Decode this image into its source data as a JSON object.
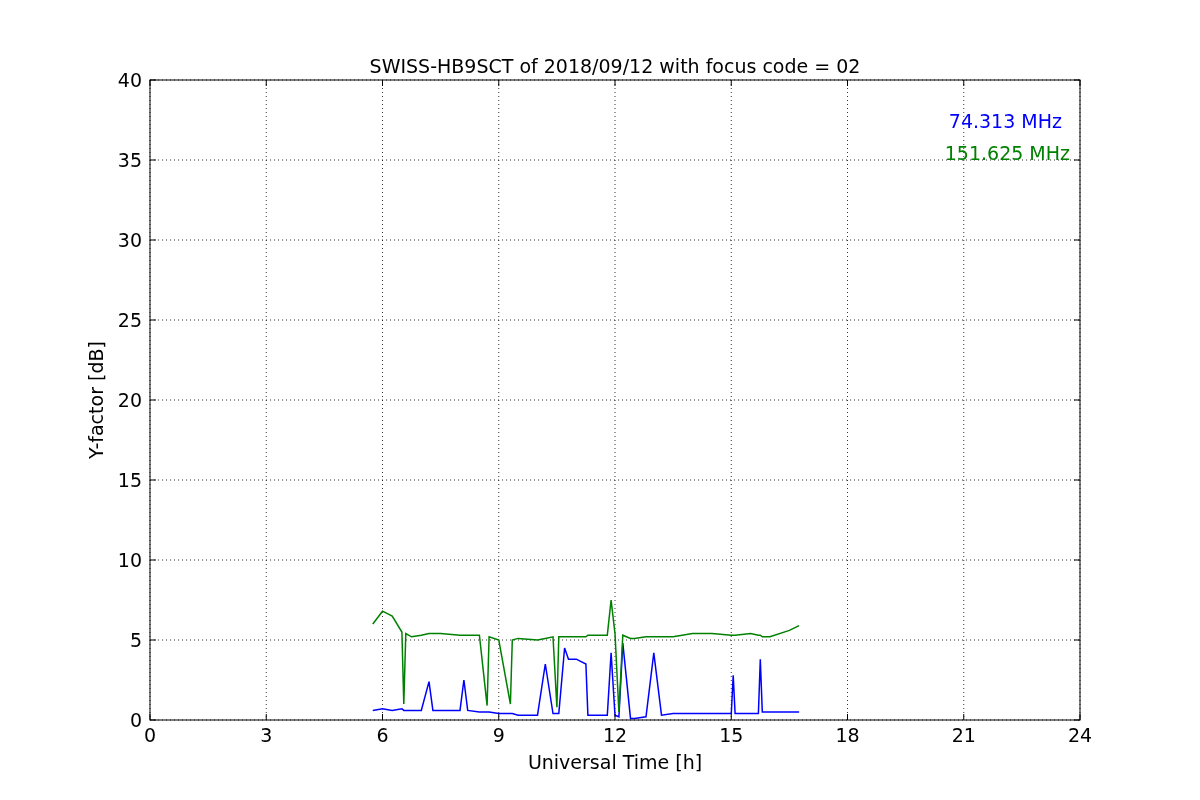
{
  "chart_data": {
    "type": "line",
    "title": "SWISS-HB9SCT of 2018/09/12 with focus code = 02",
    "xlabel": "Universal Time [h]",
    "ylabel": "Y-factor [dB]",
    "xlim": [
      0,
      24
    ],
    "ylim": [
      0,
      40
    ],
    "xticks": [
      0,
      3,
      6,
      9,
      12,
      15,
      18,
      21,
      24
    ],
    "yticks": [
      0,
      5,
      10,
      15,
      20,
      25,
      30,
      35,
      40
    ],
    "grid": true,
    "x": [
      5.75,
      6.0,
      6.25,
      6.5,
      6.55,
      6.6,
      6.75,
      7.0,
      7.2,
      7.3,
      7.5,
      8.0,
      8.1,
      8.2,
      8.5,
      8.7,
      8.75,
      9.0,
      9.3,
      9.35,
      9.5,
      10.0,
      10.2,
      10.4,
      10.5,
      10.55,
      10.7,
      10.8,
      11.0,
      11.25,
      11.3,
      11.5,
      11.8,
      11.9,
      12.0,
      12.1,
      12.2,
      12.4,
      12.5,
      12.8,
      13.0,
      13.2,
      13.5,
      14.0,
      14.5,
      15.0,
      15.05,
      15.1,
      15.5,
      15.7,
      15.75,
      15.8,
      16.0,
      16.5,
      16.75
    ],
    "series": [
      {
        "name": "74.313 MHz",
        "color": "#0000ff",
        "values": [
          0.6,
          0.7,
          0.6,
          0.7,
          0.6,
          0.6,
          0.6,
          0.6,
          2.4,
          0.6,
          0.6,
          0.6,
          2.5,
          0.6,
          0.5,
          0.5,
          0.5,
          0.4,
          0.4,
          0.4,
          0.3,
          0.3,
          3.5,
          0.4,
          0.4,
          0.4,
          4.5,
          3.8,
          3.8,
          3.5,
          0.3,
          0.3,
          0.3,
          4.2,
          0.3,
          0.2,
          4.8,
          0.1,
          0.1,
          0.2,
          4.2,
          0.3,
          0.4,
          0.4,
          0.4,
          0.4,
          2.8,
          0.4,
          0.4,
          0.4,
          3.8,
          0.5,
          0.5,
          0.5,
          0.5
        ]
      },
      {
        "name": "151.625 MHz",
        "color": "#008000",
        "values": [
          6.0,
          6.8,
          6.5,
          5.5,
          1.0,
          5.4,
          5.2,
          5.3,
          5.4,
          5.4,
          5.4,
          5.3,
          5.3,
          5.3,
          5.3,
          0.9,
          5.2,
          5.0,
          1.0,
          5.0,
          5.1,
          5.0,
          5.1,
          5.2,
          0.8,
          5.2,
          5.2,
          5.2,
          5.2,
          5.2,
          5.3,
          5.3,
          5.3,
          7.5,
          5.4,
          0.5,
          5.3,
          5.1,
          5.1,
          5.2,
          5.2,
          5.2,
          5.2,
          5.4,
          5.4,
          5.3,
          5.3,
          5.3,
          5.4,
          5.3,
          5.3,
          5.2,
          5.2,
          5.6,
          5.9
        ]
      }
    ]
  }
}
